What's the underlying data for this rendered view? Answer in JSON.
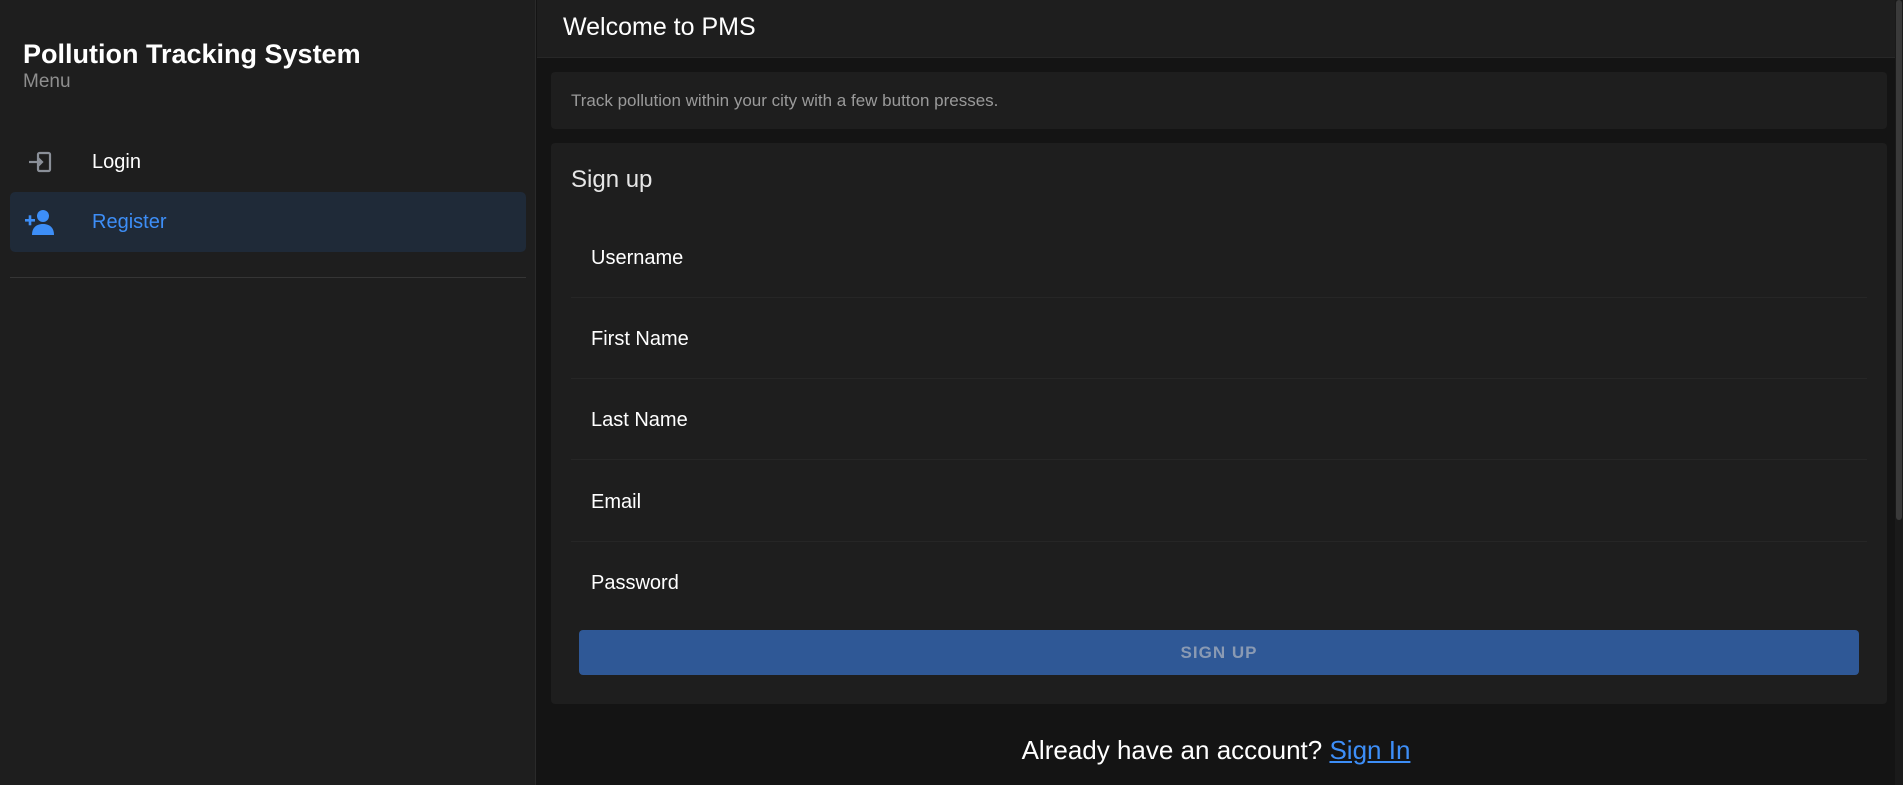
{
  "sidebar": {
    "title": "Pollution Tracking System",
    "subtitle": "Menu",
    "items": [
      {
        "label": "Login",
        "icon": "login-icon",
        "active": false
      },
      {
        "label": "Register",
        "icon": "person-add-icon",
        "active": true
      }
    ]
  },
  "header": {
    "title": "Welcome to PMS"
  },
  "intro": {
    "text": "Track pollution within your city with a few button presses."
  },
  "signup": {
    "title": "Sign up",
    "fields": [
      {
        "placeholder": "Username",
        "value": ""
      },
      {
        "placeholder": "First Name",
        "value": ""
      },
      {
        "placeholder": "Last Name",
        "value": ""
      },
      {
        "placeholder": "Email",
        "value": ""
      },
      {
        "placeholder": "Password",
        "value": ""
      }
    ],
    "button_label": "SIGN UP"
  },
  "footer": {
    "prompt": "Already have an account?",
    "link_label": "Sign In"
  },
  "colors": {
    "accent": "#3d8ef7",
    "button": "#2f5896",
    "background": "#141414",
    "surface": "#1e1e1e"
  }
}
